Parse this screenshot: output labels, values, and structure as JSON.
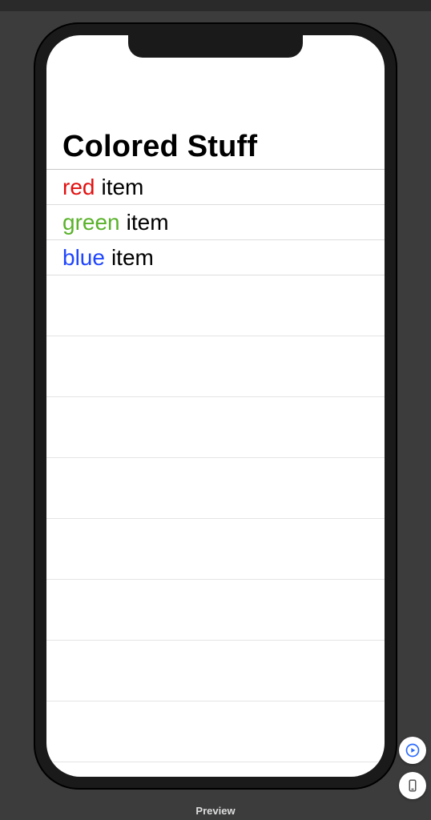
{
  "preview": {
    "label": "Preview",
    "play_tooltip": "Live Preview",
    "device_tooltip": "Device Settings"
  },
  "app": {
    "title": "Colored Stuff",
    "items": [
      {
        "color_name": "red",
        "color_hex": "#e30f0f",
        "label": "item"
      },
      {
        "color_name": "green",
        "color_hex": "#59b22a",
        "label": "item"
      },
      {
        "color_name": "blue",
        "color_hex": "#1f46ff",
        "label": "item"
      }
    ],
    "empty_rows": 9
  },
  "colors": {
    "device_frame": "#1a1a1a",
    "background": "#3c3c3c",
    "row_separator": "#dddddd",
    "accent_blue": "#2b6bff"
  }
}
